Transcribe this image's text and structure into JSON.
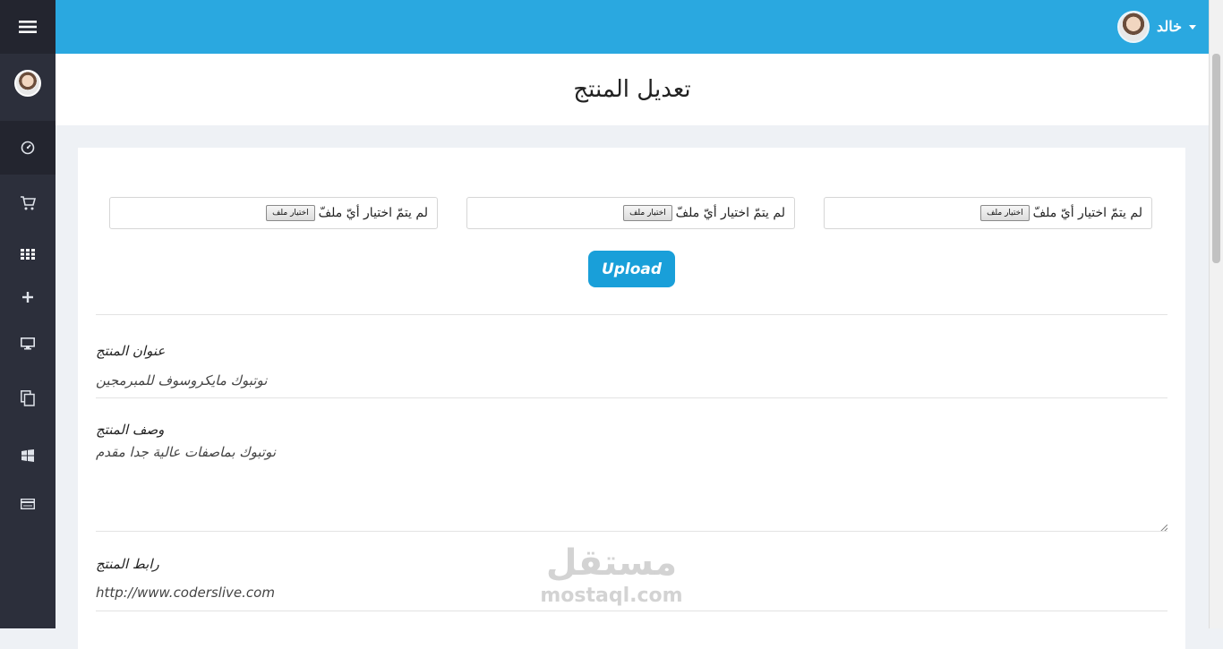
{
  "topbar": {
    "user_name": "خالد",
    "accent_color": "#2aa8e0"
  },
  "sidebar": {
    "items": [
      {
        "icon": "menu-icon"
      },
      {
        "icon": "avatar"
      },
      {
        "icon": "dashboard-icon"
      },
      {
        "icon": "cart-icon"
      },
      {
        "icon": "grid-icon"
      },
      {
        "icon": "plus-icon"
      },
      {
        "icon": "monitor-icon"
      },
      {
        "icon": "copy-icon"
      },
      {
        "icon": "windows-icon"
      },
      {
        "icon": "card-icon"
      }
    ]
  },
  "page": {
    "title": "تعديل المنتج"
  },
  "uploads": {
    "files": [
      {
        "button_label": "اختيار ملف",
        "status": "لم يتمّ اختيار أيّ ملفّ"
      },
      {
        "button_label": "اختيار ملف",
        "status": "لم يتمّ اختيار أيّ ملفّ"
      },
      {
        "button_label": "اختيار ملف",
        "status": "لم يتمّ اختيار أيّ ملفّ"
      }
    ],
    "upload_label": "Upload"
  },
  "form": {
    "title_label": "عنوان المنتج",
    "title_value": "نوتبوك مايكروسوف للمبرمجين",
    "description_label": "وصف المنتج",
    "description_value": "نوتبوك بماصفات عالية جدا مقدم",
    "link_label": "رابط المنتج",
    "link_value": "http://www.coderslive.com"
  },
  "watermark": {
    "arabic": "مستقل",
    "latin": "mostaql.com"
  }
}
